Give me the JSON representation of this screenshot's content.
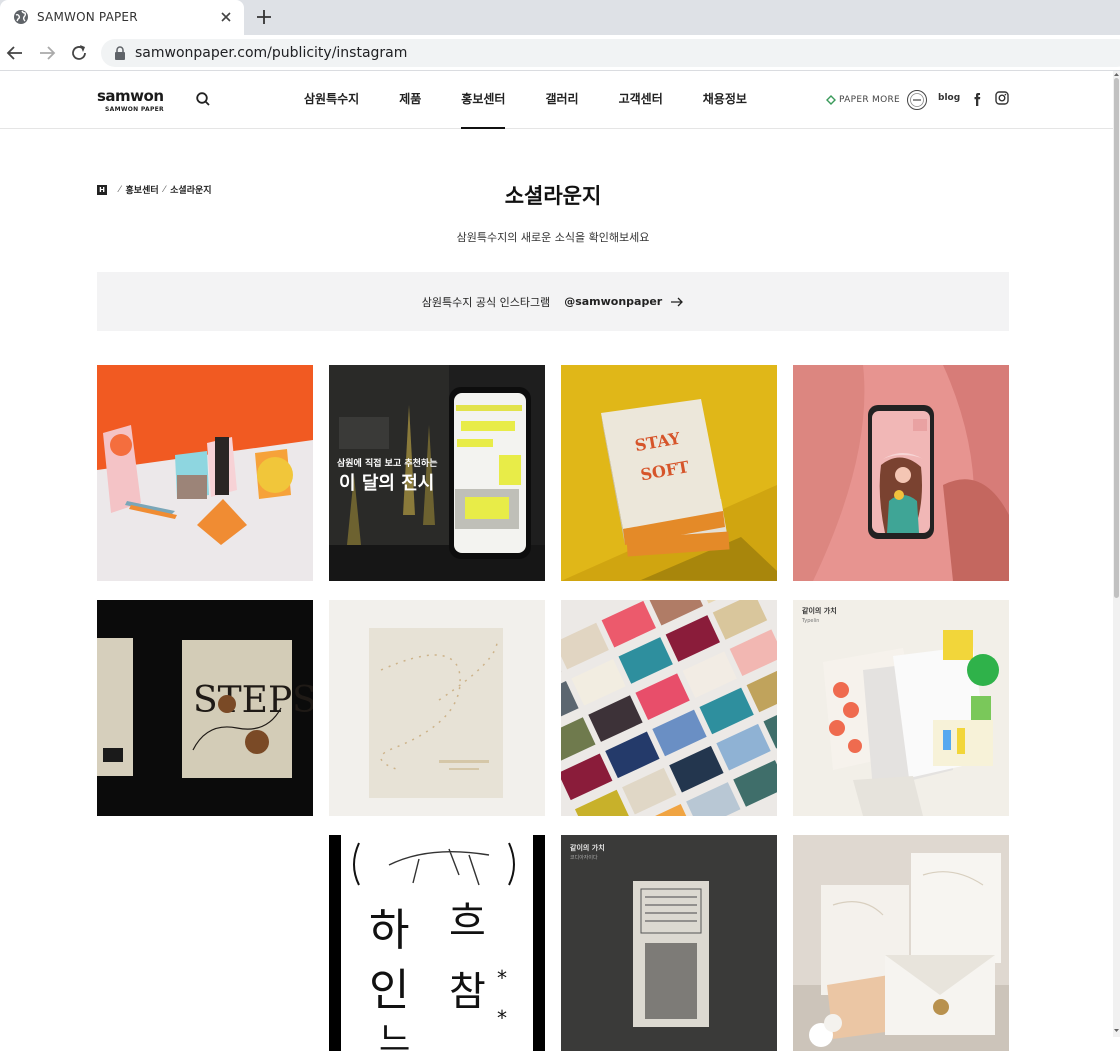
{
  "browser": {
    "tab_title": "SAMWON PAPER",
    "url": "samwonpaper.com/publicity/instagram"
  },
  "header": {
    "logo_word": "samwon",
    "logo_sub": "SAMWON PAPER",
    "nav": [
      {
        "label": "삼원특수지",
        "active": false
      },
      {
        "label": "제품",
        "active": false
      },
      {
        "label": "홍보센터",
        "active": true
      },
      {
        "label": "갤러리",
        "active": false
      },
      {
        "label": "고객센터",
        "active": false
      },
      {
        "label": "채용정보",
        "active": false
      }
    ],
    "papermore": "PAPER MORE",
    "blog": "blog"
  },
  "breadcrumb": {
    "home": "H",
    "items": [
      "홍보센터",
      "소셜라운지"
    ]
  },
  "page": {
    "title": "소셜라운지",
    "subtitle": "삼원특수지의 새로운 소식을 확인해보세요"
  },
  "insta_bar": {
    "label": "삼원특수지 공식 인스타그램",
    "handle": "@samwonpaper"
  },
  "posts": [
    {
      "name": "paper-objects-orange",
      "bg": "#f15a22"
    },
    {
      "name": "exhibition-phone-dark",
      "overlay_text": "이 달의 전시",
      "bg": "#1e1e1e"
    },
    {
      "name": "stay-soft-boxes",
      "box_text_1": "STAY",
      "box_text_2": "SOFT",
      "bg": "#e0b718"
    },
    {
      "name": "pink-phone-illustration",
      "bg": "#e79490"
    },
    {
      "name": "steps-books",
      "cover_text": "STEPS",
      "bg": "#0b0b0b"
    },
    {
      "name": "embossed-cream-paper",
      "bg": "#e9e6e1"
    },
    {
      "name": "colorful-boxes-grid",
      "bg": "#ece9e6"
    },
    {
      "name": "value-of-together-1",
      "caption": "같이의 가치",
      "caption_sub": "Typelin",
      "bg": "#f2efe8"
    },
    {
      "name": "hangul-poster",
      "bg": "#000000"
    },
    {
      "name": "value-of-together-2",
      "caption": "같이의 가치",
      "caption_sub": "코디아자이다",
      "bg": "#3a3a39"
    },
    {
      "name": "wedding-invitations",
      "bg": "#dfd8d0"
    }
  ]
}
